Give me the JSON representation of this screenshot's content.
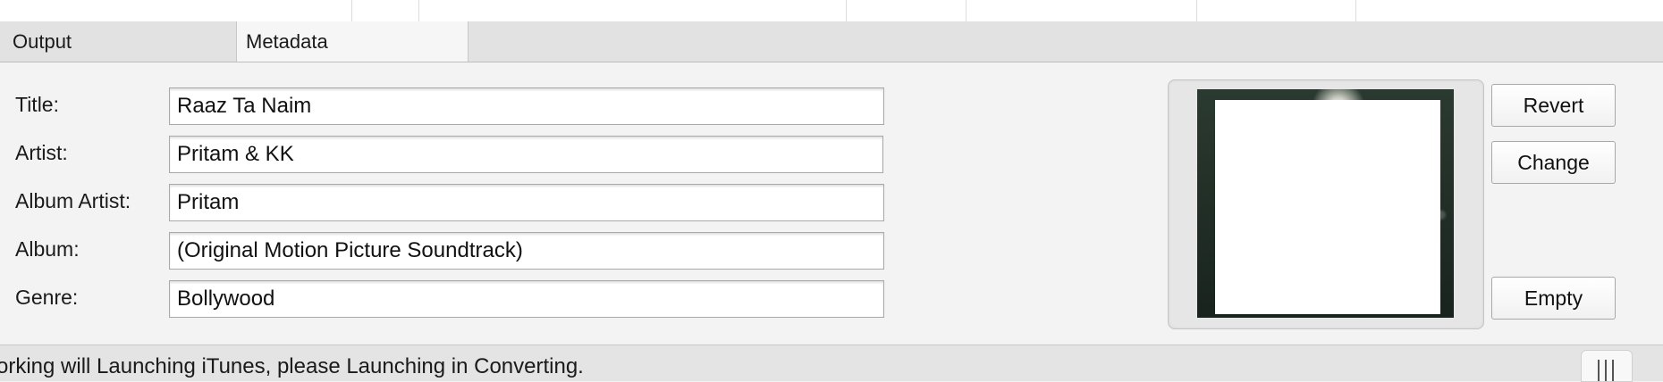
{
  "tabs": [
    {
      "label": "Output",
      "active": false
    },
    {
      "label": "Metadata",
      "active": true
    }
  ],
  "form": {
    "title": {
      "label": "Title:",
      "value": "Raaz Ta Naim"
    },
    "artist": {
      "label": "Artist:",
      "value": "Pritam & KK"
    },
    "album_artist": {
      "label": "Album Artist:",
      "value": "Pritam"
    },
    "album": {
      "label": "Album:",
      "value": "(Original Motion Picture Soundtrack)"
    },
    "genre": {
      "label": "Genre:",
      "value": "Bollywood"
    }
  },
  "buttons": {
    "revert": "Revert",
    "change": "Change",
    "empty": "Empty"
  },
  "status": {
    "message": "orking will Launching iTunes, please Launching in Converting."
  },
  "icons": {
    "artwork": "album-artwork-icon",
    "resize": "resize-grip-icon"
  }
}
